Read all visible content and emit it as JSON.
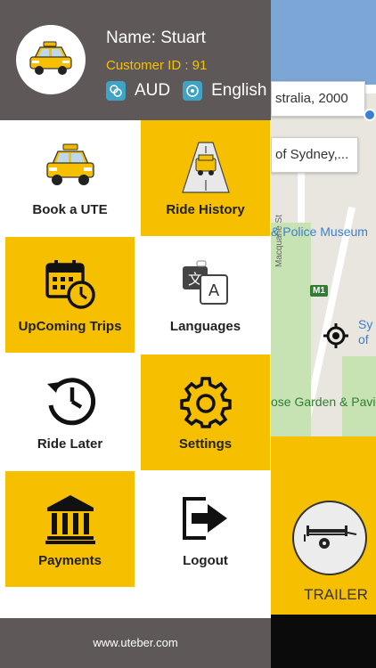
{
  "profile": {
    "name_label": "Name: Stuart",
    "customer_id_label": "Customer ID : 91",
    "currency": "AUD",
    "language": "English"
  },
  "menu": {
    "book_ute": "Book a UTE",
    "ride_history": "Ride History",
    "upcoming_trips": "UpComing Trips",
    "languages": "Languages",
    "ride_later": "Ride Later",
    "settings": "Settings",
    "payments": "Payments",
    "logout": "Logout"
  },
  "footer": {
    "website": "www.uteber.com"
  },
  "map": {
    "pickup_address": "stralia, 2000",
    "dropoff_address": "of Sydney,...",
    "museum_label": "& Police Museum",
    "street_label": "Macquarie St",
    "road_badge": "M1",
    "poi_label": "Sy\nof",
    "garden_label": "ose Garden & Pavi"
  },
  "vehicle": {
    "label": "TRAILER"
  },
  "colors": {
    "accent": "#f6c000",
    "header": "#5e5858",
    "icon_badge": "#3fa3c6"
  }
}
